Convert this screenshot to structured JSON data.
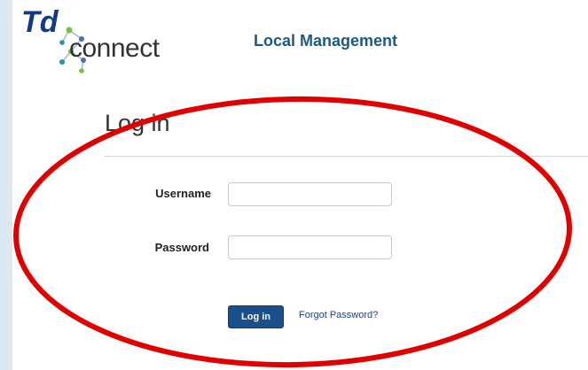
{
  "header": {
    "logo": {
      "text_td": "Td",
      "text_connect": "connect",
      "primary_color": "#123a8a",
      "accent_color": "#2a8fb8"
    },
    "app_title": "Local Management"
  },
  "login": {
    "heading": "Log in",
    "username": {
      "label": "Username",
      "value": ""
    },
    "password": {
      "label": "Password",
      "value": ""
    },
    "submit_label": "Log in",
    "forgot_password_label": "Forgot Password?"
  },
  "annotation": {
    "shape": "ellipse",
    "color": "#e00000"
  },
  "colors": {
    "title": "#1b5a85",
    "button_bg": "#1a4f8b",
    "link": "#1a3d9c",
    "left_stripe": "#dce8f2"
  }
}
